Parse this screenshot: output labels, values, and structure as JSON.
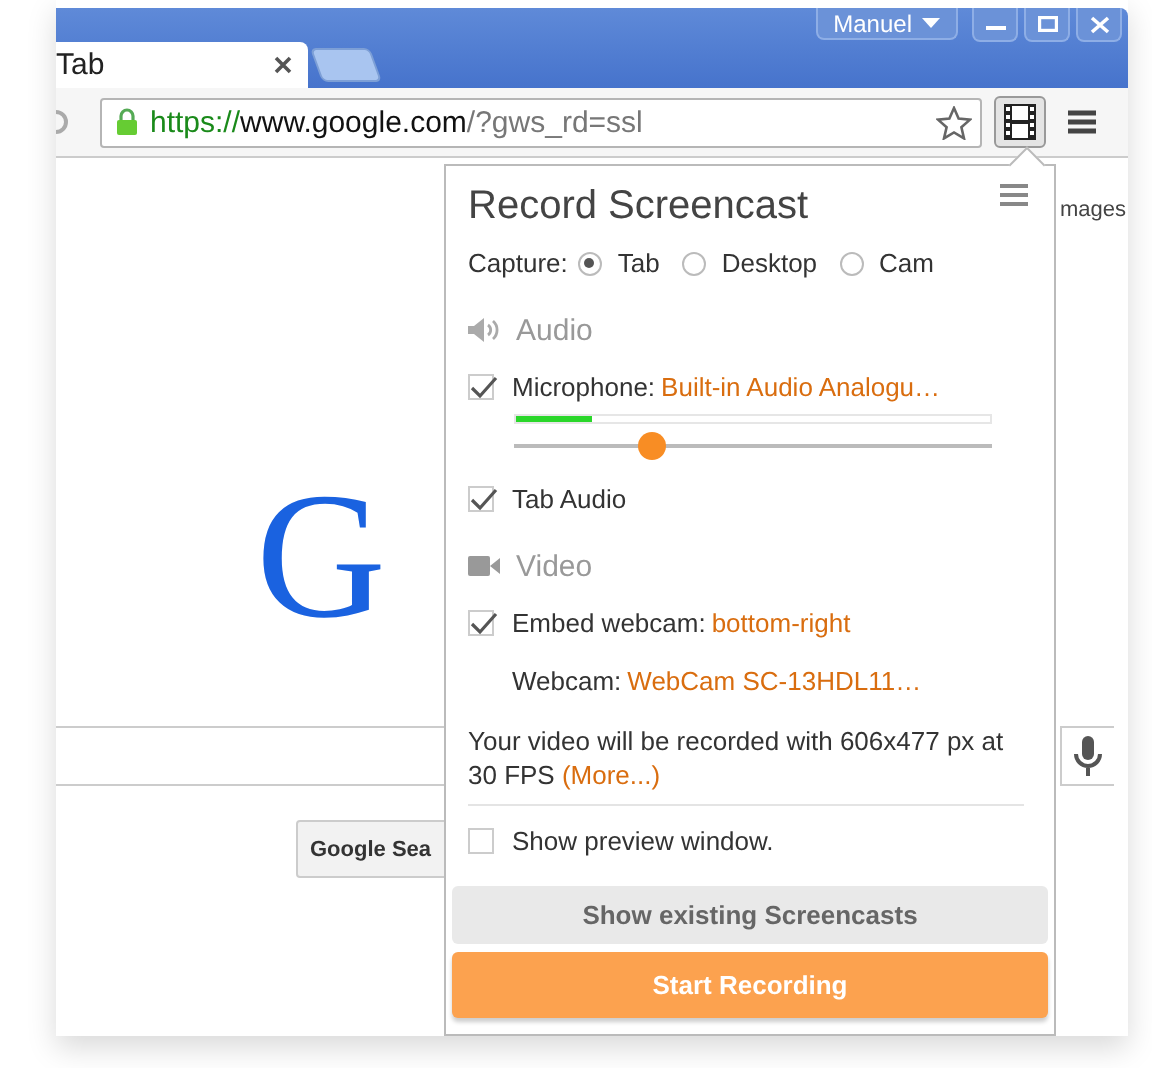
{
  "browser": {
    "profile": "Manuel",
    "tabs": [
      {
        "title": "Tab",
        "selected": true
      },
      {
        "selected": false
      }
    ],
    "address": {
      "secure": true,
      "scheme": "https://",
      "host": "www.google.com",
      "path": "/?gws_rd=ssl"
    }
  },
  "page": {
    "top_link": "mages",
    "logo": [
      {
        "letter": "G",
        "color": "#1a62e0"
      }
    ],
    "search_button": "Google Sea"
  },
  "popup": {
    "title": "Record Screencast",
    "capture": {
      "label": "Capture:",
      "options": [
        {
          "label": "Tab",
          "selected": true
        },
        {
          "label": "Desktop",
          "selected": false
        },
        {
          "label": "Cam",
          "selected": false
        }
      ]
    },
    "sections": [
      {
        "kind": "audio",
        "heading": "Audio",
        "rows": [
          {
            "kind": "check",
            "label": "Microphone:",
            "value": "Built-in Audio Analogu…",
            "checked": true
          },
          {
            "kind": "meter",
            "level": 0.16
          },
          {
            "kind": "slider",
            "level": 0.29
          },
          {
            "kind": "check",
            "label": "Tab Audio",
            "checked": true
          }
        ]
      },
      {
        "kind": "video",
        "heading": "Video",
        "rows": [
          {
            "kind": "check",
            "label": "Embed webcam:",
            "value": "bottom-right",
            "checked": true
          },
          {
            "kind": "setting",
            "label": "Webcam:",
            "value": "WebCam SC-13HDL11…"
          }
        ]
      }
    ],
    "info": {
      "text": "Your video will be recorded with 606x477 px at 30 FPS",
      "link": "(More...)"
    },
    "preview": {
      "label": "Show preview window.",
      "checked": false
    },
    "buttons": [
      {
        "kind": "secondary",
        "label": "Show existing Screencasts"
      },
      {
        "kind": "primary",
        "label": "Start Recording"
      }
    ]
  }
}
